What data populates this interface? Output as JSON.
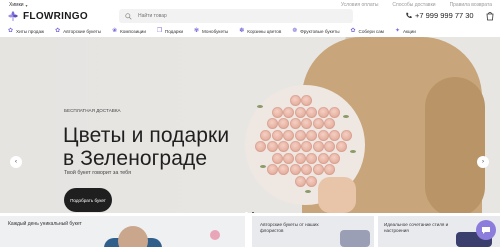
{
  "header": {
    "city": "Химки",
    "logo": "FLOWRINGO",
    "search_placeholder": "Найти товар",
    "links": [
      "Условия оплаты",
      "Способы доставки",
      "Правила возврата"
    ],
    "phone": "+7 999 999 77 30",
    "icons": {
      "logo": "flower-logo-icon",
      "search": "search-icon",
      "phone": "phone-icon",
      "cart": "cart-icon"
    }
  },
  "nav": [
    "Хиты продаж",
    "Авторские букеты",
    "Композиции",
    "Подарки",
    "Монобукеты",
    "Корзины цветов",
    "Фруктовые букеты",
    "Собери сам",
    "Акции"
  ],
  "hero": {
    "eyebrow": "БЕСПЛАТНАЯ ДОСТАВКА",
    "title_line1": "Цветы и подарки",
    "title_line2": "в Зеленограде",
    "subtitle": "Твой букет говорит за тебя",
    "cta": "Подобрать букет",
    "prev": "‹",
    "next": "›",
    "slides_count": 2,
    "active_slide": 1
  },
  "cards": {
    "card1": "Каждый день уникальный букет",
    "card2": "Авторские букеты от наших флористов",
    "card3": "Идеальное сочетание стиля и настроения"
  },
  "colors": {
    "accent": "#7a6cd9",
    "dark_button": "#1f1f1f",
    "hero_bg": "#e8e6e3"
  }
}
